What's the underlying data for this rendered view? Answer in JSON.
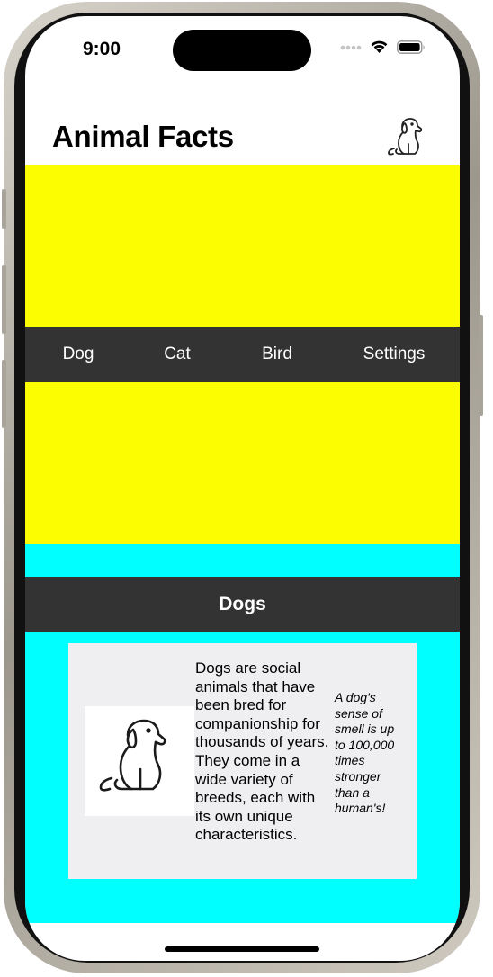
{
  "status_bar": {
    "time": "9:00",
    "icons": [
      "cellular-icon",
      "wifi-icon",
      "battery-icon"
    ]
  },
  "header": {
    "title": "Animal Facts",
    "icon": "dog-icon"
  },
  "tabs": [
    {
      "label": "Dog"
    },
    {
      "label": "Cat"
    },
    {
      "label": "Bird"
    },
    {
      "label": "Settings"
    }
  ],
  "section": {
    "title": "Dogs",
    "card": {
      "image_icon": "dog-icon",
      "body": "Dogs are social animals that have been bred for companionship for thousands of years. They come in a wide variety of breeds, each with its own unique characteristics.",
      "note": "A dog's sense of smell is up to 100,000 times stronger than a human's!"
    }
  },
  "colors": {
    "accent_yellow": "#fbfd00",
    "accent_cyan": "#00ffff",
    "bar_dark": "#333333",
    "card_bg": "#efeef0"
  }
}
